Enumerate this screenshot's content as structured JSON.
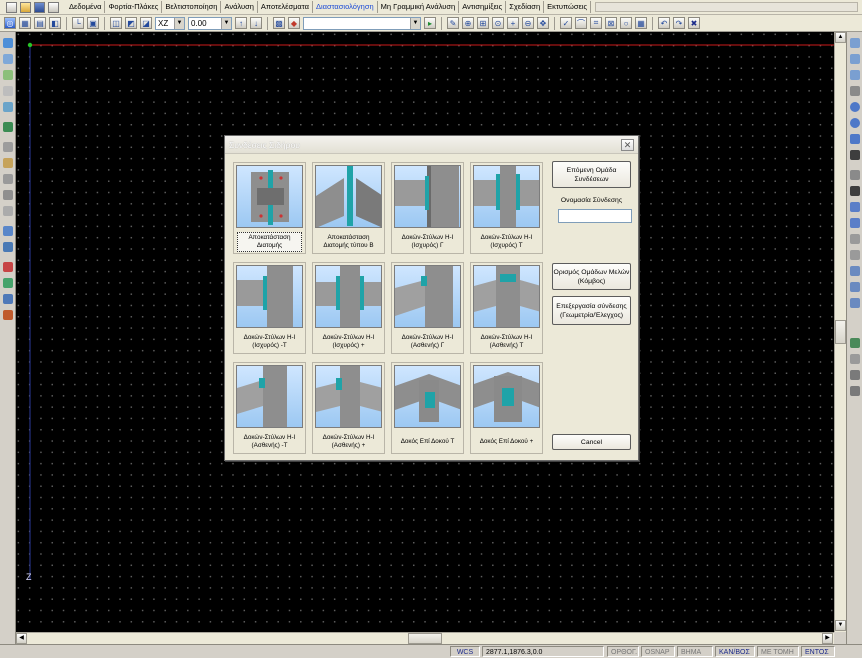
{
  "menubar": {
    "items": [
      "Δεδομένα",
      "Φορτία-Πλάκες",
      "Βελτιστοποίηση",
      "Ανάλυση",
      "Αποτελέσματα",
      "Διαστασιολόγηση",
      "Μη Γραμμική Ανάλυση",
      "Αντισημίξεις",
      "Σχεδίαση",
      "Εκτυπώσεις"
    ],
    "active_index": 5
  },
  "toolbar": {
    "plane_value": "XZ",
    "level_value": "0.00",
    "dropdown_value": ""
  },
  "canvas": {
    "axis_label": "Z"
  },
  "dialog": {
    "title": "Συνδέσεις Σιδήρου",
    "close_glyph": "✕",
    "tiles": [
      {
        "caption": "Αποκατάσταση Διατομής"
      },
      {
        "caption": "Αποκατάσταση Διατομής τύπου B"
      },
      {
        "caption": "Δοκών-Στύλων Η-Ι (Ισχυρός) Γ"
      },
      {
        "caption": "Δοκών-Στύλων Η-Ι (Ισχυρός) Τ"
      },
      {
        "caption": "Δοκών-Στύλων Η-Ι (Ισχυρός) -Τ"
      },
      {
        "caption": "Δοκών-Στύλων Η-Ι (Ισχυρός) +"
      },
      {
        "caption": "Δοκών-Στύλων Η-Ι (Ασθενής) Γ"
      },
      {
        "caption": "Δοκών-Στύλων Η-Ι (Ασθενής) Τ"
      },
      {
        "caption": "Δοκών-Στύλων Η-Ι (Ασθενής) -Τ"
      },
      {
        "caption": "Δοκών-Στύλων Η-Ι (Ασθενής) +"
      },
      {
        "caption": "Δοκός Επί Δοκού Τ"
      },
      {
        "caption": "Δοκός Επί Δοκού +"
      }
    ],
    "selected_tile": 0,
    "next_group_button": "Επόμενη Ομάδα Συνδέσεων",
    "connection_name_label": "Ονομασία Σύνδεσης",
    "connection_name_value": "",
    "define_groups_button": "Ορισμός Ομάδων Μελών (Κόμβος)",
    "edit_connection_button": "Επεξεργασία σύνδεσης (Γεωμετρία/Έλεγχος)",
    "cancel_button": "Cancel"
  },
  "statusbar": {
    "wcs": "WCS",
    "coords": "2877.1,1876.3,0.0",
    "ortho": "ΟΡΘΟΓ.",
    "osnap": "OSNAP",
    "step": "ΒΗΜΑ",
    "ortho_snap": "ΚΑΝ/ΒΟΣ",
    "intersect": "ΜΕ ΤΟΜΗ",
    "entos": "ΕΝΤΟΣ"
  },
  "colors": {
    "canvas_bg": "#000000",
    "grid_dot": "#5c5c5c",
    "x_axis": "#cc1a1a",
    "z_axis": "#2b3a9a",
    "origin": "#27c427",
    "steel": "#8e8e8e",
    "plate": "#1fa3a8",
    "sky": "#a9d0f5"
  }
}
